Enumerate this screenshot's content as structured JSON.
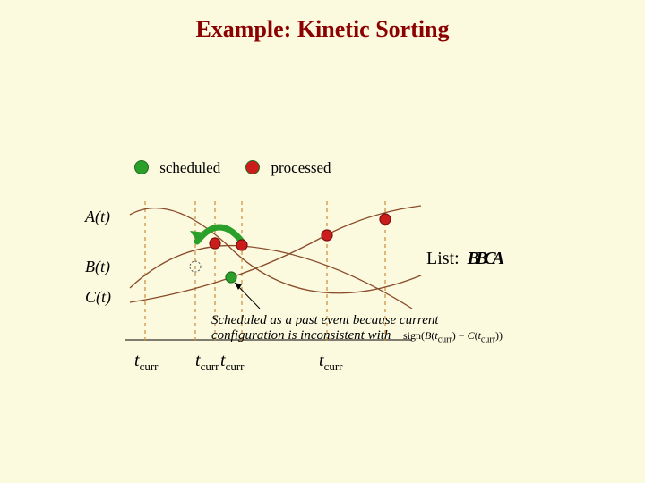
{
  "title": "Example: Kinetic Sorting",
  "legend": {
    "scheduled": "scheduled",
    "processed": "processed"
  },
  "axis": {
    "A": "A(t)",
    "B": "B(t)",
    "C": "C(t)"
  },
  "tlabels": {
    "t1": "t",
    "t1sub": "curr",
    "t2": "t",
    "t2sub": "curr",
    "t3": "t",
    "t3sub": "curr",
    "t4": "t",
    "t4sub": "curr"
  },
  "list": {
    "label": "List:",
    "value": "BBCA"
  },
  "note_line1": "Scheduled as a past event because current",
  "note_line2": "configuration is inconsistent with",
  "formula": "sign(B(t_curr) − C(t_curr))"
}
